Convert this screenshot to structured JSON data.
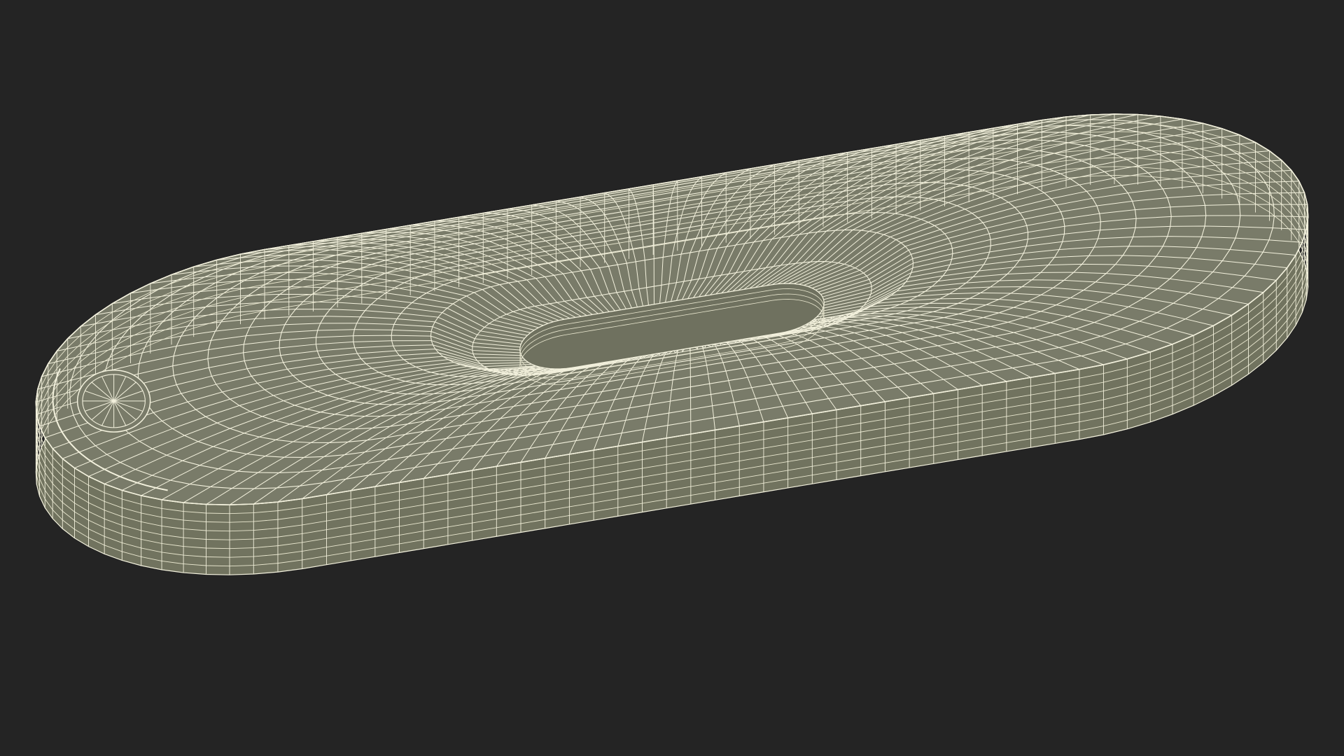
{
  "scene": {
    "subject": "wireframe-model",
    "colors": {
      "background": "#242424",
      "surface": "#797b69",
      "surface_side": "#71735f",
      "wire": "#f3f1dd",
      "wire_dense": "#e9e7cf"
    },
    "mesh": {
      "radial_segments": 64,
      "inner_rings": 10,
      "side_bands": 7
    }
  }
}
